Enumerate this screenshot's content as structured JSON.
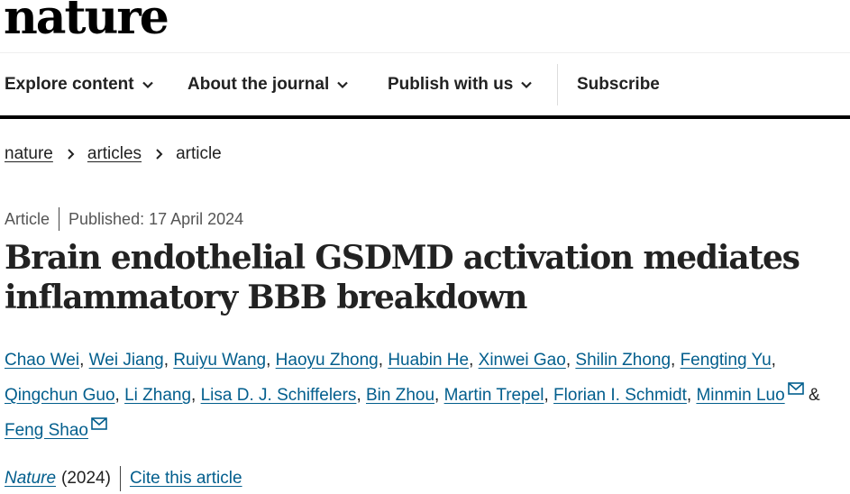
{
  "site": {
    "logo": "nature"
  },
  "nav": {
    "items": [
      {
        "label": "Explore content",
        "dropdown": true
      },
      {
        "label": "About the journal",
        "dropdown": true
      },
      {
        "label": "Publish with us",
        "dropdown": true
      },
      {
        "label": "Subscribe",
        "dropdown": false
      }
    ],
    "chevron_icon": "chevron-down-icon"
  },
  "breadcrumb": {
    "items": [
      "nature",
      "articles",
      "article"
    ],
    "separator_icon": "chevron-right-icon"
  },
  "article": {
    "type": "Article",
    "published": "Published: 17 April 2024",
    "title": "Brain endothelial GSDMD activation mediates inflammatory BBB breakdown",
    "authors": [
      "Chao Wei",
      "Wei Jiang",
      "Ruiyu Wang",
      "Haoyu Zhong",
      "Huabin He",
      "Xinwei Gao",
      "Shilin Zhong",
      "Fengting Yu",
      "Qingchun Guo",
      "Li Zhang",
      "Lisa D. J. Schiffelers",
      "Bin Zhou",
      "Martin Trepel",
      "Florian I. Schmidt",
      "Minmin Luo",
      "Feng Shao"
    ],
    "corresponding_icon": "mail-icon",
    "ampersand": "&",
    "journal": "Nature",
    "year": "(2024)",
    "cite": "Cite this article"
  },
  "colors": {
    "link": "#025e8d",
    "text": "#222222",
    "rule": "#000000"
  }
}
